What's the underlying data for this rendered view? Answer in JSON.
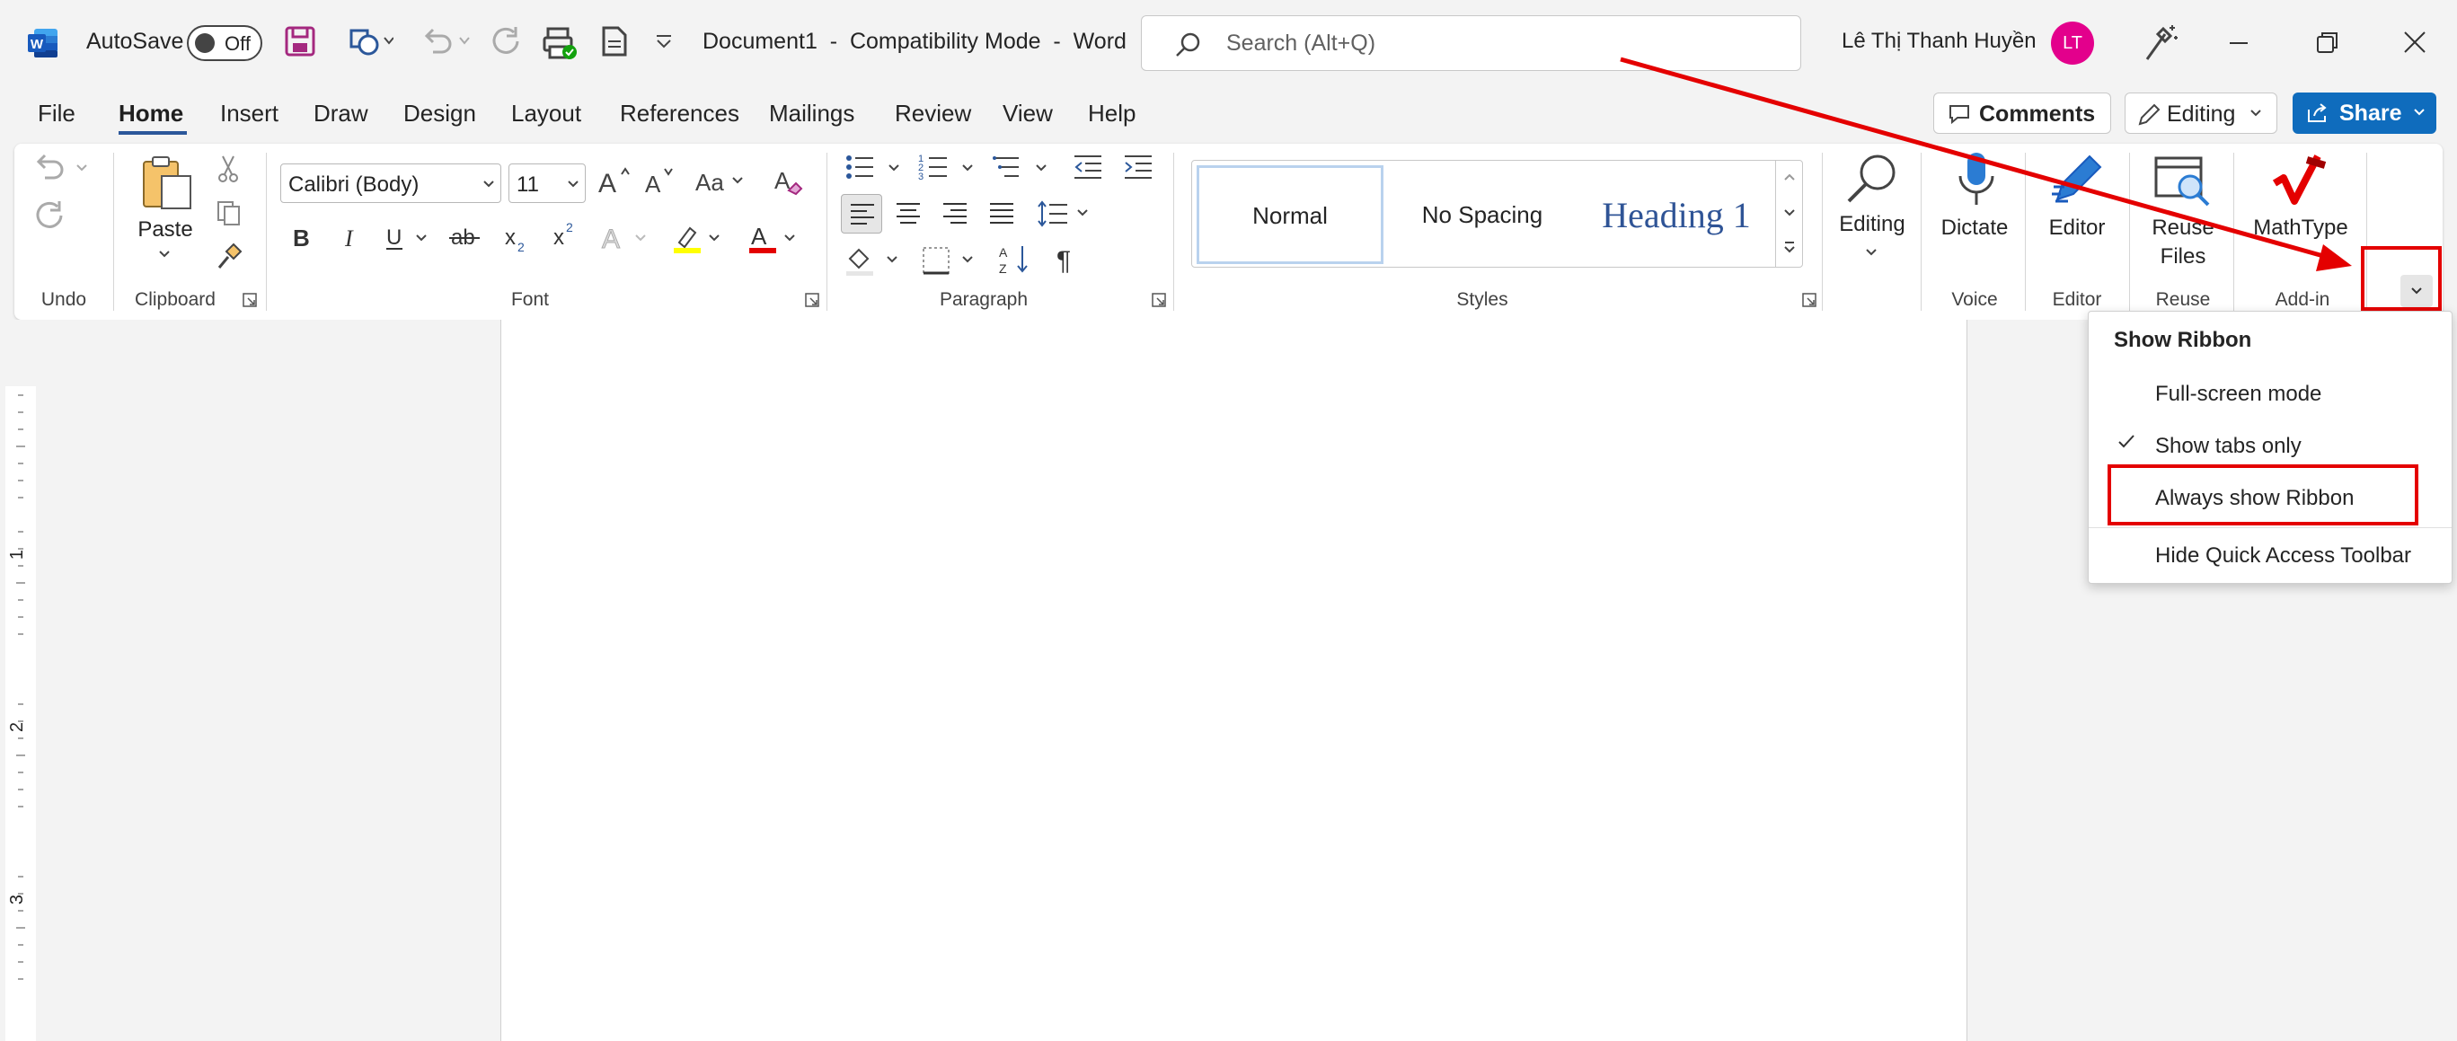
{
  "titlebar": {
    "autosave_label": "AutoSave",
    "autosave_state": "Off",
    "doc_title": "Document1  -  Compatibility Mode  -  Word",
    "search_placeholder": "Search (Alt+Q)",
    "user_name": "Lê Thị Thanh Huyền",
    "avatar_initials": "LT",
    "accent_color": "#2b579a"
  },
  "tabs": [
    "File",
    "Home",
    "Insert",
    "Draw",
    "Design",
    "Layout",
    "References",
    "Mailings",
    "Review",
    "View",
    "Help"
  ],
  "active_tab": "Home",
  "actions": {
    "comments": "Comments",
    "editing": "Editing",
    "share": "Share"
  },
  "ribbon": {
    "groups": {
      "undo": "Undo",
      "clipboard": "Clipboard",
      "font": "Font",
      "paragraph": "Paragraph",
      "styles": "Styles",
      "editing": "",
      "voice": "Voice",
      "editor": "Editor",
      "reuse": "Reuse Files",
      "addin": "Add-in"
    },
    "paste": "Paste",
    "font_name": "Calibri (Body)",
    "font_size": "11",
    "styles": {
      "normal": "Normal",
      "no_spacing": "No Spacing",
      "heading1": "Heading 1"
    },
    "editing_btn": "Editing",
    "dictate": "Dictate",
    "editor": "Editor",
    "reuse_line1": "Reuse",
    "reuse_line2": "Files",
    "mathtype": "MathType"
  },
  "ruler_numbers": [
    "1",
    "2",
    "3"
  ],
  "menu": {
    "title": "Show Ribbon",
    "items": [
      {
        "label": "Full-screen mode",
        "checked": false
      },
      {
        "label": "Show tabs only",
        "checked": true
      },
      {
        "label": "Always show Ribbon",
        "checked": false
      },
      {
        "label": "Hide Quick Access Toolbar",
        "checked": false
      }
    ]
  },
  "colors": {
    "share_bg": "#0f6cbd",
    "avatar_bg": "#e3008c",
    "annotation_red": "#e40000"
  }
}
